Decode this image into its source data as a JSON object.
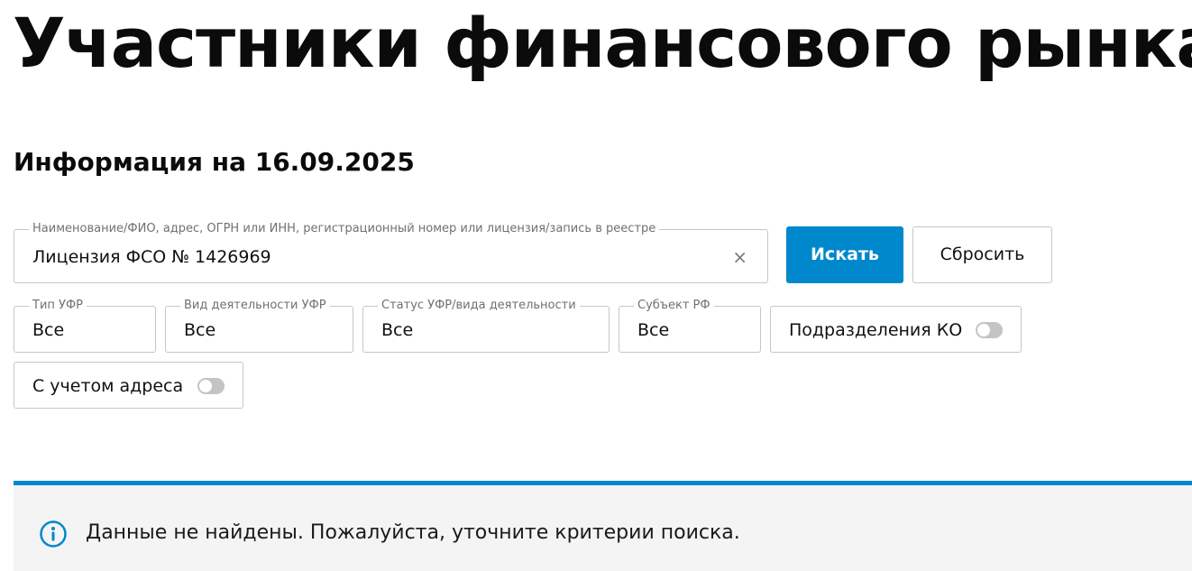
{
  "page": {
    "title": "Участники финансового рынка",
    "info_date": "Информация на 16.09.2025"
  },
  "search": {
    "legend": "Наименование/ФИО, адрес, ОГРН или ИНН, регистрационный номер или лицензия/запись в реестре",
    "value": "Лицензия ФСО № 1426969",
    "clear_glyph": "×",
    "search_button": "Искать",
    "reset_button": "Сбросить"
  },
  "filters": {
    "type": {
      "legend": "Тип УФР",
      "value": "Все"
    },
    "activity": {
      "legend": "Вид деятельности УФР",
      "value": "Все"
    },
    "status": {
      "legend": "Статус УФР/вида деятельности",
      "value": "Все"
    },
    "region": {
      "legend": "Субъект РФ",
      "value": "Все"
    }
  },
  "toggles": {
    "divisions": {
      "label": "Подразделения КО",
      "on": false
    },
    "address": {
      "label": "С учетом адреса",
      "on": false
    }
  },
  "notice": {
    "text": "Данные не найдены. Пожалуйста, уточните критерии поиска.",
    "icon": "info-icon"
  },
  "colors": {
    "accent": "#0088cc",
    "notice_bg": "#f4f4f4",
    "switch_off": "#c4c4c4"
  }
}
